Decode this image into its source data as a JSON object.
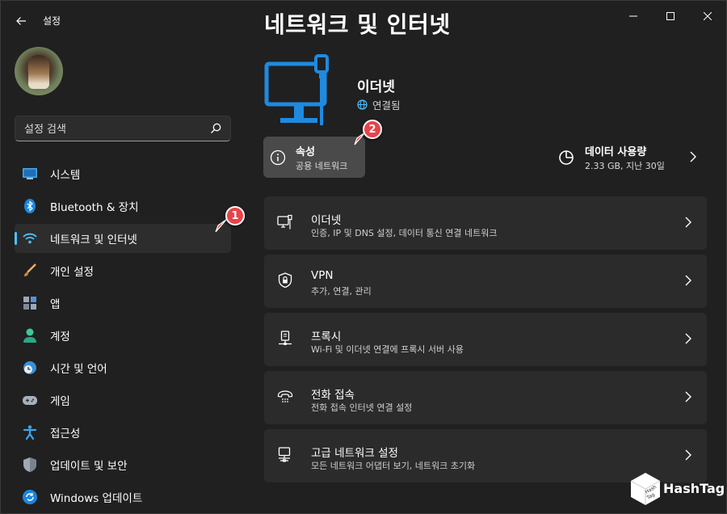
{
  "app": {
    "title": "설정",
    "back_icon": "arrow-left-icon",
    "window_controls": [
      "minimize-icon",
      "maximize-icon",
      "close-icon"
    ]
  },
  "sidebar": {
    "search": {
      "placeholder": "설정 검색",
      "value": ""
    },
    "items": [
      {
        "label": "시스템",
        "icon": "system-display-icon",
        "active": false
      },
      {
        "label": "Bluetooth & 장치",
        "icon": "bluetooth-icon",
        "active": false
      },
      {
        "label": "네트워크 및 인터넷",
        "icon": "wifi-icon",
        "active": true
      },
      {
        "label": "개인 설정",
        "icon": "brush-icon",
        "active": false
      },
      {
        "label": "앱",
        "icon": "apps-icon",
        "active": false
      },
      {
        "label": "계정",
        "icon": "person-icon",
        "active": false
      },
      {
        "label": "시간 및 언어",
        "icon": "clock-globe-icon",
        "active": false
      },
      {
        "label": "게임",
        "icon": "gamepad-icon",
        "active": false
      },
      {
        "label": "접근성",
        "icon": "accessibility-icon",
        "active": false
      },
      {
        "label": "업데이트 및 보안",
        "icon": "shield-icon",
        "active": false
      },
      {
        "label": "Windows 업데이트",
        "icon": "refresh-icon",
        "active": false
      }
    ]
  },
  "main": {
    "page_title": "네트워크 및 인터넷",
    "connection": {
      "name": "이더넷",
      "status": "연결됨",
      "icon": "ethernet-monitor-icon"
    },
    "properties": {
      "title": "속성",
      "subtitle": "공용 네트워크",
      "icon": "info-icon"
    },
    "data_usage": {
      "title": "데이터 사용량",
      "subtitle": "2.33 GB, 지난 30일",
      "icon": "pie-chart-icon"
    },
    "cards": [
      {
        "title": "이더넷",
        "subtitle": "인증, IP 및 DNS 설정, 데이터 통신 연결 네트워크",
        "icon": "ethernet-icon"
      },
      {
        "title": "VPN",
        "subtitle": "추가, 연결, 관리",
        "icon": "vpn-shield-icon"
      },
      {
        "title": "프록시",
        "subtitle": "Wi-Fi 및 이더넷 연결에 프록시 서버 사용",
        "icon": "proxy-icon"
      },
      {
        "title": "전화 접속",
        "subtitle": "전화 접속 인터넷 연결 설정",
        "icon": "dialup-icon"
      },
      {
        "title": "고급 네트워크 설정",
        "subtitle": "모든 네트워크 어댑터 보기, 네트워크 초기화",
        "icon": "advanced-network-icon"
      }
    ]
  },
  "annotations": {
    "badge1": "1",
    "badge2": "2"
  },
  "watermark": {
    "text": "HashTag",
    "cube_text": "Hash Tag"
  },
  "colors": {
    "accent": "#4cc2ff",
    "background": "#202020",
    "card": "#2b2b2b",
    "badge": "#e8434a"
  }
}
